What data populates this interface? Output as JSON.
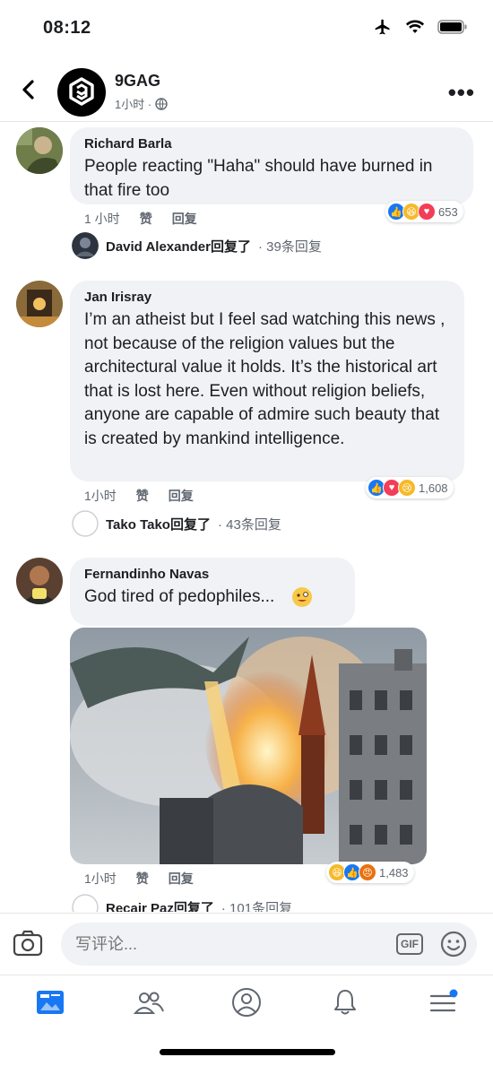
{
  "status": {
    "time": "08:12"
  },
  "header": {
    "page_name": "9GAG",
    "meta": "1小时 ·"
  },
  "comments": [
    {
      "author": "Richard Barla",
      "text": "People reacting \"Haha\" should have burned in that fire too",
      "time": "1 小时",
      "like": "赞",
      "reply": "回复",
      "reaction_count": "653",
      "reply_author": "David Alexander回复了",
      "reply_count": "· 39条回复"
    },
    {
      "author": "Jan Irisray",
      "text": "I’m an atheist but I feel sad watching this news , not because of the religion values but the architectural value it holds. It’s the historical art that is lost here. Even without religion beliefs, anyone are capable of admire such beauty that is created by mankind intelligence.",
      "time": "1小时",
      "like": "赞",
      "reply": "回复",
      "reaction_count": "1,608",
      "reply_author": "Tako Tako回复了",
      "reply_count": "· 43条回复"
    },
    {
      "author": "Fernandinho Navas",
      "text": "God tired of pedophiles...",
      "time": "1小时",
      "like": "赞",
      "reply": "回复",
      "reaction_count": "1,483",
      "reply_author": "Recair Paz回复了",
      "reply_count": "· 101条回复"
    }
  ],
  "composer": {
    "placeholder": "写评论...",
    "gif_label": "GIF"
  },
  "colors": {
    "facebook_blue": "#1877f2",
    "bubble_gray": "#f0f2f5",
    "meta_gray": "#606770"
  }
}
